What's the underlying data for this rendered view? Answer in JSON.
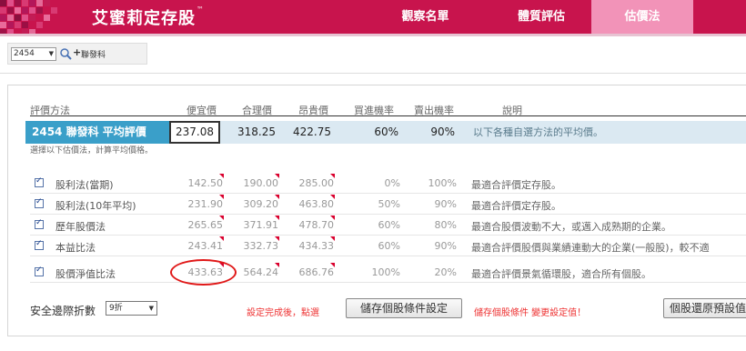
{
  "app": {
    "brand": "艾蜜莉定存股",
    "brand_mark": "™",
    "nav": [
      "觀察名單",
      "體質評估",
      "估價法"
    ],
    "active_nav": "估價法",
    "brand_color": "#c8144d"
  },
  "selector": {
    "code": "2454",
    "name": "聯發科",
    "icons": [
      "dropdown-icon",
      "search-icon",
      "plus-icon"
    ]
  },
  "table": {
    "headers": {
      "method": "評價方法",
      "cheap": "便宜價",
      "fair": "合理價",
      "expensive": "昂貴價",
      "buy_prob": "買進機率",
      "sell_prob": "賣出機率",
      "desc": "說明"
    },
    "average": {
      "label": "2454 聯發科  平均評價",
      "cheap": "237.08",
      "fair": "318.25",
      "expensive": "422.75",
      "buy_prob": "60%",
      "sell_prob": "90%",
      "desc": "以下各種自選方法的平均價。"
    },
    "note": "選擇以下估價法，計算平均價格。",
    "rows": [
      {
        "method": "股利法(當期)",
        "cheap": "142.50",
        "fair": "190.00",
        "expensive": "285.00",
        "buy_prob": "0%",
        "sell_prob": "100%",
        "desc": "最適合評價定存股。",
        "checked": true
      },
      {
        "method": "股利法(10年平均)",
        "cheap": "231.90",
        "fair": "309.20",
        "expensive": "463.80",
        "buy_prob": "50%",
        "sell_prob": "90%",
        "desc": "最適合評價定存股。",
        "checked": true
      },
      {
        "method": "歷年股價法",
        "cheap": "265.65",
        "fair": "371.91",
        "expensive": "478.70",
        "buy_prob": "60%",
        "sell_prob": "80%",
        "desc": "最適合股價波動不大，或邁入成熟期的企業。",
        "checked": true
      },
      {
        "method": "本益比法",
        "cheap": "243.41",
        "fair": "332.73",
        "expensive": "434.33",
        "buy_prob": "60%",
        "sell_prob": "90%",
        "desc": "最適合評價股價與業績連動大的企業(一般股)，較不適",
        "checked": true
      },
      {
        "method": "股價淨值比法",
        "cheap": "433.63",
        "fair": "564.24",
        "expensive": "686.76",
        "buy_prob": "100%",
        "sell_prob": "20%",
        "desc": "最適合評價景氣循環股，適合所有個股。",
        "checked": true
      }
    ]
  },
  "controls": {
    "safety_label": "安全邊際折數",
    "safety_value": "9折",
    "done_text": "設定完成後，點選",
    "save_button": "儲存個股條件設定",
    "save_hint": "儲存個股條件 變更設定值！",
    "restore_button": "個股還原預設值"
  }
}
